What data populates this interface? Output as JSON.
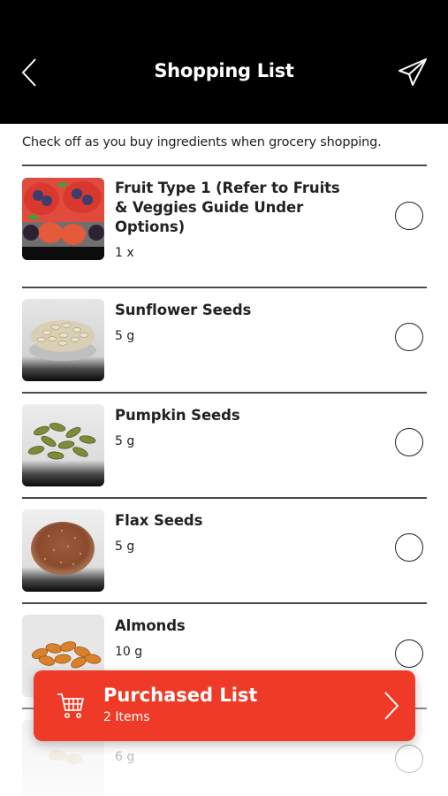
{
  "header": {
    "title": "Shopping List",
    "back_icon": "chevron-left-icon",
    "share_icon": "paper-plane-icon"
  },
  "subtitle": "Check off as you buy ingredients when grocery shopping.",
  "items": [
    {
      "name": "Fruit Type 1 (Refer to Fruits & Veggies Guide Under Options)",
      "qty": "1 x",
      "checked": false
    },
    {
      "name": "Sunflower Seeds",
      "qty": "5 g",
      "checked": false
    },
    {
      "name": "Pumpkin Seeds",
      "qty": "5 g",
      "checked": false
    },
    {
      "name": "Flax Seeds",
      "qty": "5 g",
      "checked": false
    },
    {
      "name": "Almonds",
      "qty": "10 g",
      "checked": false
    },
    {
      "name": "",
      "qty": "6 g",
      "checked": false
    }
  ],
  "purchased_bar": {
    "label": "Purchased List",
    "count": "2 Items",
    "icon": "shopping-cart-icon"
  },
  "colors": {
    "header_bg": "#000000",
    "accent": "#ee3a26"
  }
}
